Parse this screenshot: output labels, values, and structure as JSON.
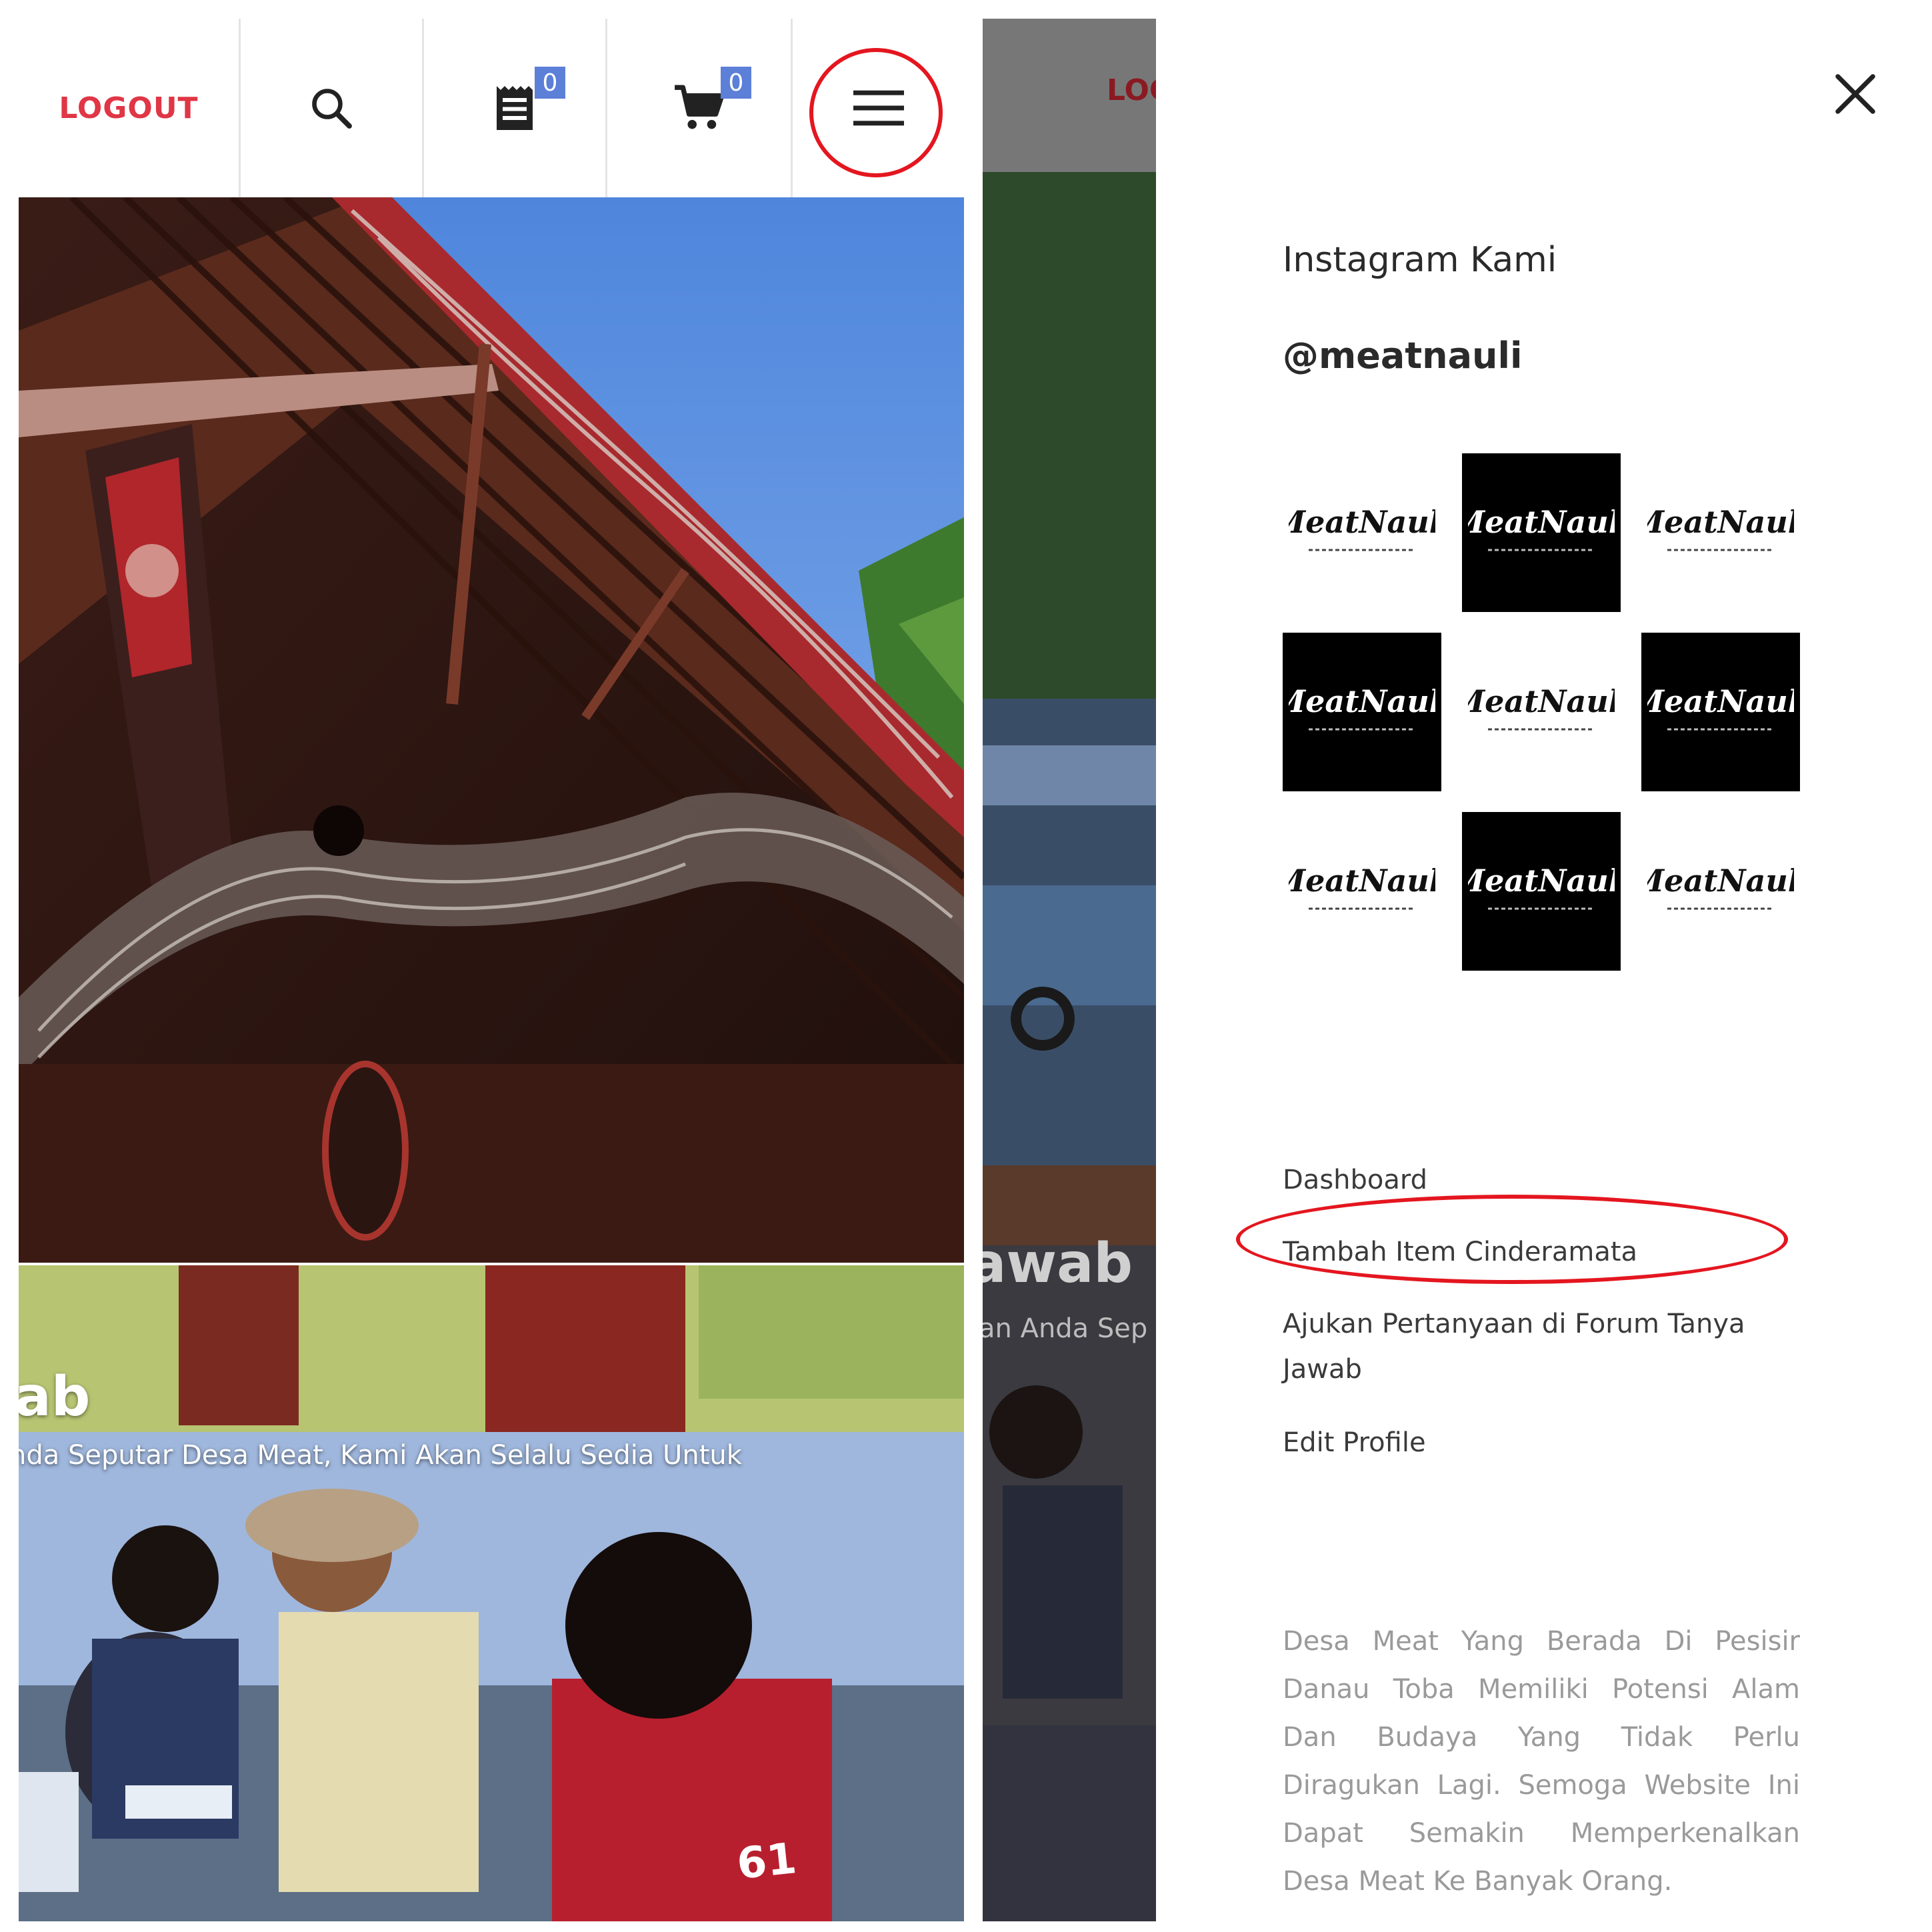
{
  "left_header": {
    "logout_label": "LOGOUT",
    "orders_badge": "0",
    "cart_badge": "0"
  },
  "hero": {
    "title_fragment": "vab",
    "subtitle_fragment": "nda Seputar Desa Meat, Kami Akan Selalu Sedia Untuk"
  },
  "right_background": {
    "logout_fragment": "LOG",
    "title_fragment": "awab",
    "subtitle_fragment": "an Anda Sep"
  },
  "drawer": {
    "instagram_title": "Instagram Kami",
    "instagram_handle": "@meatnauli",
    "tile_logo_text": "MeatNauli",
    "nav": {
      "dashboard": "Dashboard",
      "tambah_item": "Tambah Item Cinderamata",
      "ajukan_line1": "Ajukan Pertanyaan di Forum Tanya",
      "ajukan_line2": "Jawab",
      "edit_profile": "Edit Profile"
    },
    "about_text": "Desa Meat Yang Berada Di Pesisir Danau Toba Memiliki Potensi Alam Dan Budaya Yang Tidak Perlu Diragukan Lagi. Semoga Website Ini Dapat Semakin Memperkenalkan Desa Meat Ke Banyak Orang."
  },
  "colors": {
    "logout_red": "#e03645",
    "badge_blue": "#5c7fd8",
    "annotation_red": "#e4161f"
  },
  "icons": [
    "search-icon",
    "receipt-icon",
    "cart-icon",
    "hamburger-menu-icon",
    "close-icon"
  ]
}
